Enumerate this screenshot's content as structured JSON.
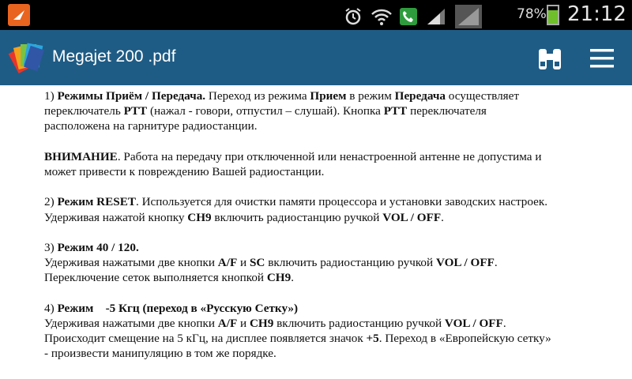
{
  "status_bar": {
    "icons": [
      "notification-app-icon",
      "alarm-icon",
      "wifi-icon",
      "call-icon",
      "signal-icon",
      "signal-icon-2"
    ],
    "battery_percent": "78%",
    "time": "21:12"
  },
  "toolbar": {
    "title": "Megajet 200 .pdf",
    "find_icon": "binoculars-icon",
    "menu_icon": "menu-icon"
  },
  "document": {
    "p1": {
      "num": "1)",
      "heading": "Режимы Приём / Передача.",
      "t1": " Переход из режима ",
      "b1": "Прием",
      "t2": " в режим ",
      "b2": "Передача",
      "t3": " осуществляет",
      "line2a": "переключатель ",
      "b3": "PTT",
      "line2b": " (нажал - говори, отпустил – слушай). Кнопка ",
      "b4": "PTT",
      "line2c": " переключателя",
      "line3": "расположена на гарнитуре радиостанции."
    },
    "p2": {
      "heading": "ВНИМАНИЕ",
      "t1": ". Работа на передачу при отключенной или ненастроенной антенне не допустима и",
      "line2": "может привести к повреждению Вашей радиостанции."
    },
    "p3": {
      "num": "2)",
      "heading": "Режим RESET",
      "t1": ". Используется для очистки памяти процессора и установки заводских настроек.",
      "line2a": "Удерживая нажатой кнопку ",
      "b1": "CH9",
      "line2b": " включить радиостанцию ручкой ",
      "b2": "VOL / OFF",
      "line2c": "."
    },
    "p4": {
      "num": "3)",
      "heading": "Режим 40 / 120.",
      "line2a": "Удерживая нажатыми две кнопки ",
      "b1": "A/F",
      "line2b": " и ",
      "b2": "SC",
      "line2c": " включить радиостанцию ручкой ",
      "b3": "VOL / OFF",
      "line2d": ".",
      "line3a": "Переключение сеток выполняется кнопкой ",
      "b4": "CH9",
      "line3b": "."
    },
    "p5": {
      "num": "4)",
      "heading": "Режим    -5 Кгц (переход в «Русскую Сетку»)",
      "line2a": "Удерживая нажатыми две кнопки ",
      "b1": "A/F",
      "line2b": " и ",
      "b2": "CH9",
      "line2c": " включить радиостанцию ручкой ",
      "b3": "VOL / OFF",
      "line2d": ".",
      "line3a": "Происходит смещение на 5 кГц, на дисплее появляется значок ",
      "b4": "+5",
      "line3b": ". Переход в «Европейскую сетку»",
      "line4": "- произвести манипуляцию в том же порядке."
    }
  }
}
